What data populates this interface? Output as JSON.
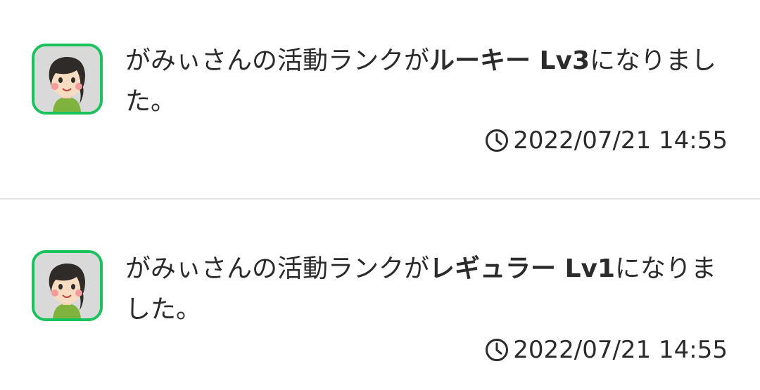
{
  "notifications": [
    {
      "user": "がみぃさん",
      "text_before": "の活動ランクが",
      "rank": "ルーキー Lv3",
      "text_after": "になりました。",
      "timestamp": "2022/07/21 14:55",
      "avatar_icon": "user-avatar-icon"
    },
    {
      "user": "がみぃさん",
      "text_before": "の活動ランクが",
      "rank": "レギュラー Lv1",
      "text_after": "になりました。",
      "timestamp": "2022/07/21 14:55",
      "avatar_icon": "user-avatar-icon"
    }
  ],
  "colors": {
    "avatar_border": "#19c25a",
    "divider": "#e6e6e6",
    "text": "#2b2b2b"
  }
}
